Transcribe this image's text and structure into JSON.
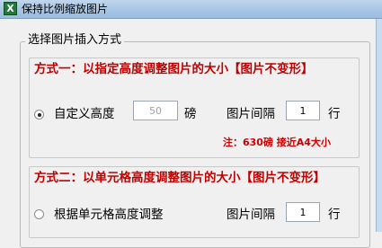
{
  "window": {
    "title": "保持比例缩放图片",
    "icon": "excel-icon",
    "icon_glyph": "X"
  },
  "group": {
    "legend": "选择图片插入方式"
  },
  "method1": {
    "title": "方式一：以指定高度调整图片的大小【图片不变形】",
    "radio_label": "自定义高度",
    "radio_checked": true,
    "height_value": "50",
    "unit": "磅",
    "spacing_label": "图片间隔",
    "spacing_value": "1",
    "spacing_unit": "行",
    "note": "注：630磅 接近A4大小"
  },
  "method2": {
    "title": "方式二：以单元格高度调整图片的大小【图片不变形】",
    "radio_label": "根据单元格高度调整",
    "radio_checked": false,
    "spacing_label": "图片间隔",
    "spacing_value": "1",
    "spacing_unit": "行"
  },
  "colors": {
    "accent_red": "#c00000",
    "note_red": "#d00000",
    "titlebar": "#a9c6e6"
  }
}
